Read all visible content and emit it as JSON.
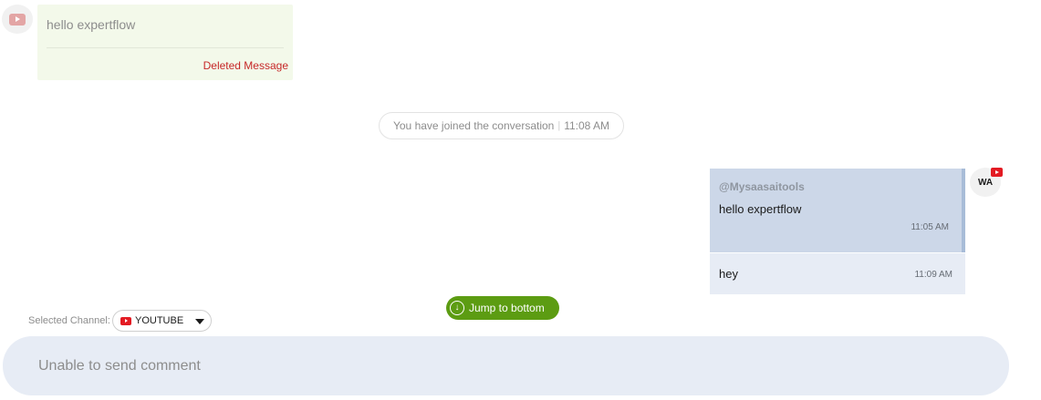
{
  "deleted_message": {
    "icon": "youtube-icon",
    "text": "hello expertflow",
    "status": "Deleted Message"
  },
  "system_notice": {
    "text": "You have joined the conversation",
    "separator": "|",
    "time": "11:08 AM"
  },
  "outgoing": {
    "avatar_initials": "WA",
    "avatar_badge_icon": "youtube-icon",
    "messages": [
      {
        "sender": "@Mysaasaitools",
        "text": "hello expertflow",
        "time": "11:05 AM"
      },
      {
        "sender": "",
        "text": "hey",
        "time": "11:09 AM"
      }
    ]
  },
  "jump_button": {
    "label": "Jump to bottom",
    "icon": "arrow-down-circle-icon"
  },
  "channel": {
    "label": "Selected Channel:",
    "selected": "YOUTUBE",
    "icon": "youtube-icon"
  },
  "composer": {
    "text": "Unable to send comment"
  },
  "colors": {
    "accent_green": "#5c9c12",
    "youtube_red": "#e31b23",
    "deleted_red": "#c62828",
    "outgoing_bubble": "#ccd7e8",
    "composer_bg": "#e7ecf5"
  }
}
